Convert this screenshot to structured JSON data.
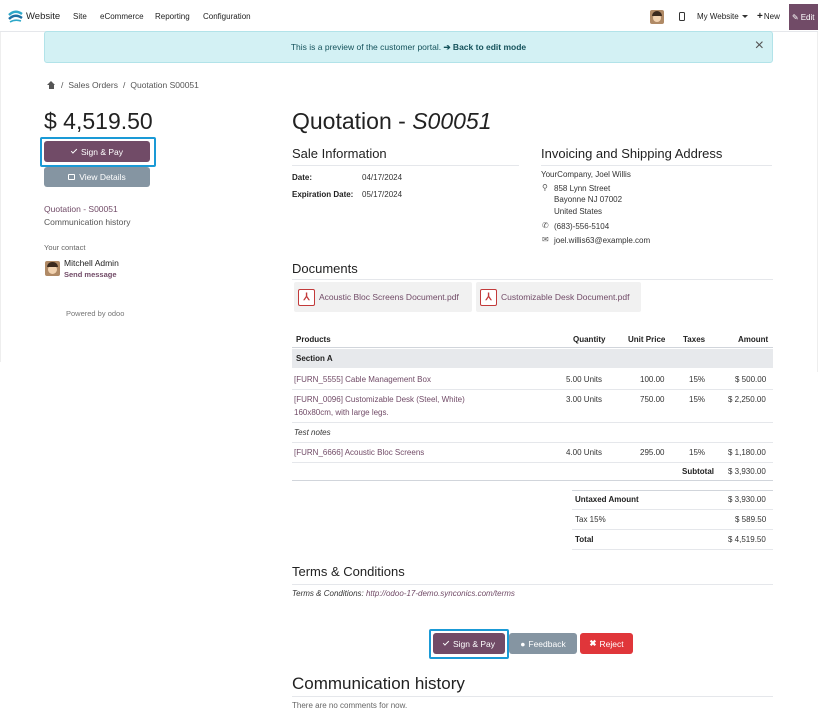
{
  "nav": {
    "brand": "Website",
    "menu": [
      "Site",
      "eCommerce",
      "Reporting",
      "Configuration"
    ],
    "my_website": "My Website",
    "new": "New",
    "edit": "Edit"
  },
  "banner": {
    "text": "This is a preview of the customer portal.",
    "link": "➔ Back to edit mode",
    "close": "×"
  },
  "breadcrumb": [
    "Sales Orders",
    "Quotation S00051"
  ],
  "sidebar": {
    "amount": "$ 4,519.50",
    "sign_pay": "Sign & Pay",
    "view_details": "View Details",
    "quotation_link": "Quotation - S00051",
    "comm_link": "Communication history",
    "contact_label": "Your contact",
    "contact_name": "Mitchell Admin",
    "send_message": "Send message",
    "powered_by": "Powered by odoo"
  },
  "main": {
    "title_prefix": "Quotation - ",
    "title_ref": "S00051",
    "sale_info_heading": "Sale Information",
    "date_label": "Date:",
    "date_value": "04/17/2024",
    "exp_label": "Expiration Date:",
    "exp_value": "05/17/2024",
    "addr_heading": "Invoicing and Shipping Address",
    "addr_company": "YourCompany, Joel Willis",
    "addr_street": "858 Lynn Street",
    "addr_city": "Bayonne NJ 07002",
    "addr_country": "United States",
    "addr_phone": "(683)-556-5104",
    "addr_email": "joel.willis63@example.com",
    "docs_heading": "Documents",
    "documents": [
      "Acoustic Bloc Screens Document.pdf",
      "Customizable Desk Document.pdf"
    ]
  },
  "table": {
    "headers": [
      "Products",
      "Quantity",
      "Unit Price",
      "Taxes",
      "Amount"
    ],
    "section": "Section A",
    "rows": [
      {
        "product": "[FURN_5555] Cable Management Box",
        "qty": "5.00 Units",
        "price": "100.00",
        "tax": "15%",
        "amount": "$ 500.00"
      },
      {
        "product": "[FURN_0096] Customizable Desk (Steel, White)",
        "product2": "160x80cm, with large legs.",
        "qty": "3.00 Units",
        "price": "750.00",
        "tax": "15%",
        "amount": "$ 2,250.00"
      },
      {
        "product": "[FURN_6666] Acoustic Bloc Screens",
        "qty": "4.00 Units",
        "price": "295.00",
        "tax": "15%",
        "amount": "$ 1,180.00"
      }
    ],
    "note": "Test notes",
    "subtotal_label": "Subtotal",
    "subtotal": "$ 3,930.00",
    "untaxed_label": "Untaxed Amount",
    "untaxed": "$ 3,930.00",
    "tax_label": "Tax 15%",
    "tax": "$ 589.50",
    "total_label": "Total",
    "total": "$ 4,519.50"
  },
  "terms": {
    "heading": "Terms & Conditions",
    "prefix": "Terms & Conditions:",
    "link": "http://odoo-17-demo.synconics.com/terms"
  },
  "actions": {
    "sign_pay": "Sign & Pay",
    "feedback": "Feedback",
    "reject": "Reject"
  },
  "communication": {
    "heading": "Communication history",
    "empty": "There are no comments for now."
  },
  "colors": {
    "primary": "#714b67",
    "banner_bg": "#d3f1f4",
    "focus": "#1a9ad6",
    "danger": "#e0363a",
    "secondary": "#8595a2"
  }
}
